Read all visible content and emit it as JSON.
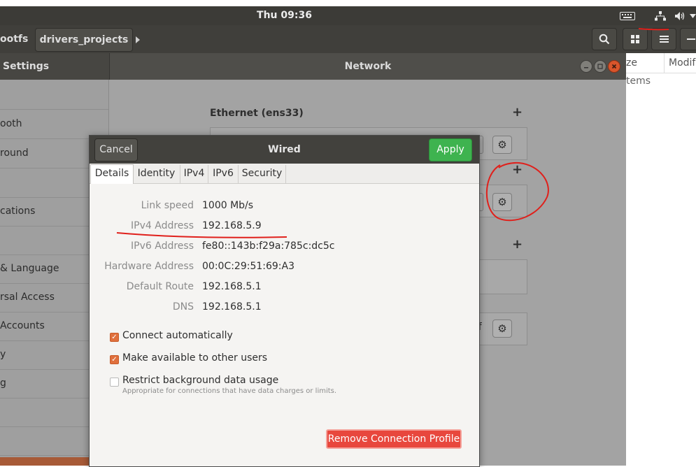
{
  "panel": {
    "clock": "Thu 09:36",
    "icons": {
      "keyboard": "keyboard-icon",
      "network": "network-icon",
      "volume": "volume-icon"
    }
  },
  "file_manager": {
    "tabs": [
      {
        "label": "ootfs"
      },
      {
        "label": "drivers_projects"
      }
    ],
    "columns": [
      "ze",
      "Modif"
    ],
    "status": "tems"
  },
  "settings": {
    "title_left": "Settings",
    "title_center": "Network",
    "sidebar_items": [
      {
        "label": "ooth"
      },
      {
        "label": "round"
      },
      {
        "label": ""
      },
      {
        "label": "cations"
      },
      {
        "label": ""
      },
      {
        "label": "& Language"
      },
      {
        "label": "rsal Access"
      },
      {
        "label": "Accounts"
      },
      {
        "label": "y"
      },
      {
        "label": "g"
      }
    ],
    "ethernet_title": "Ethernet (ens33)",
    "faded_text": "ff"
  },
  "dialog": {
    "title": "Wired",
    "cancel_label": "Cancel",
    "apply_label": "Apply",
    "tabs": [
      "Details",
      "Identity",
      "IPv4",
      "IPv6",
      "Security"
    ],
    "details": [
      {
        "label": "Link speed",
        "value": "1000 Mb/s"
      },
      {
        "label": "IPv4 Address",
        "value": "192.168.5.9"
      },
      {
        "label": "IPv6 Address",
        "value": "fe80::143b:f29a:785c:dc5c"
      },
      {
        "label": "Hardware Address",
        "value": "00:0C:29:51:69:A3"
      },
      {
        "label": "Default Route",
        "value": "192.168.5.1"
      },
      {
        "label": "DNS",
        "value": "192.168.5.1"
      }
    ],
    "options": {
      "connect_automatically": {
        "label": "Connect automatically",
        "checked": true
      },
      "available_to_others": {
        "label": "Make available to other users",
        "checked": true
      },
      "restrict_background": {
        "label": "Restrict background data usage",
        "hint": "Appropriate for connections that have data charges or limits.",
        "checked": false
      }
    },
    "remove_label": "Remove Connection Profile"
  },
  "colors": {
    "accent_orange": "#e0703d",
    "apply_green": "#3eb34f",
    "remove_red": "#e8473d",
    "annotation_red": "#e0201b"
  }
}
